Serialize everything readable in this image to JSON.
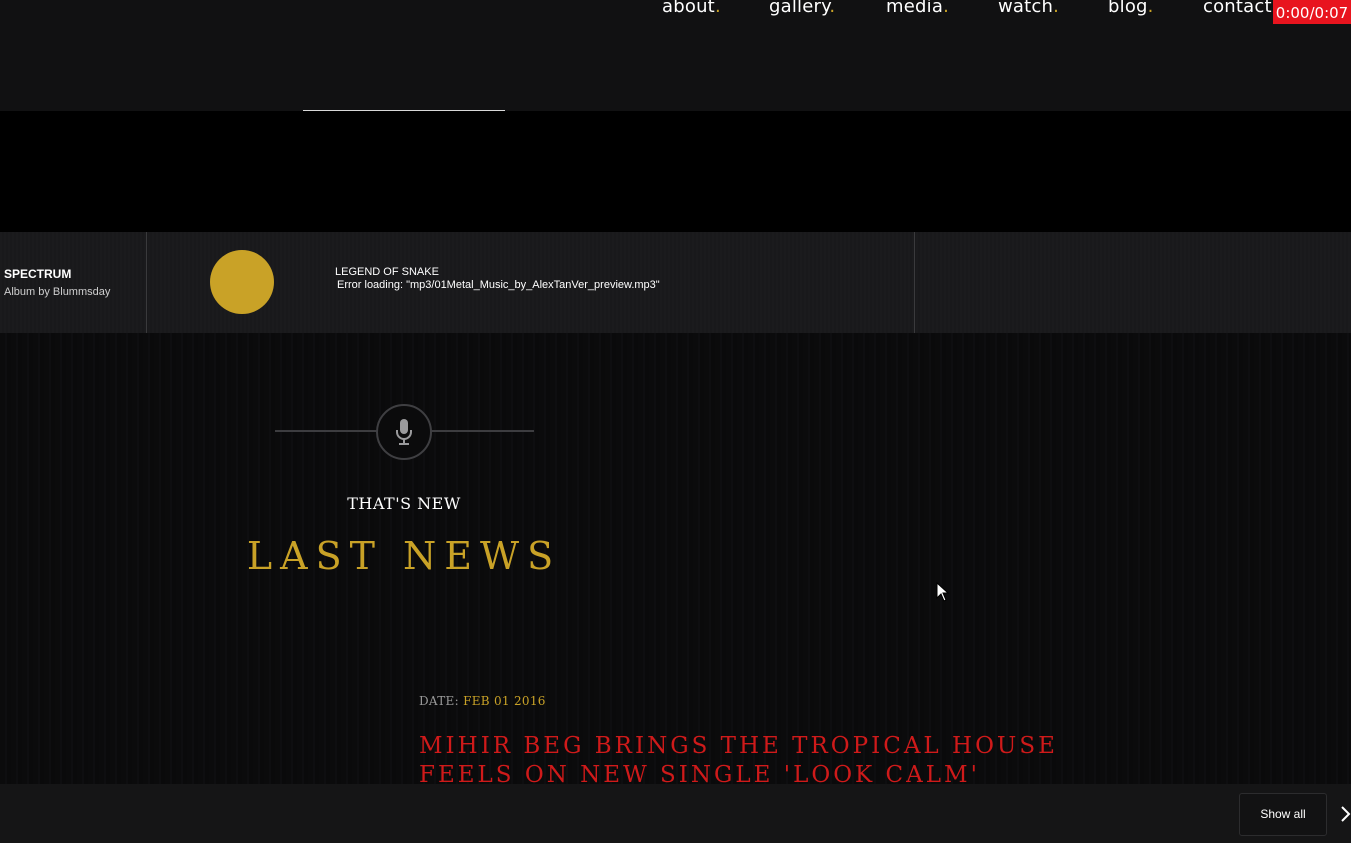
{
  "nav": {
    "items": [
      {
        "label": "about",
        "dot": "."
      },
      {
        "label": "gallery",
        "dot": "."
      },
      {
        "label": "media",
        "dot": "."
      },
      {
        "label": "watch",
        "dot": "."
      },
      {
        "label": "blog",
        "dot": "."
      },
      {
        "label": "contact",
        "dot": "."
      }
    ],
    "timer": "0:00/0:07"
  },
  "player": {
    "album_title": "SPECTRUM",
    "album_subtitle": "Album by Blummsday",
    "track_title": "LEGEND OF SNAKE",
    "error_text": "Error loading: \"mp3/01Metal_Music_by_AlexTanVer_preview.mp3\""
  },
  "section": {
    "icon": "microphone-icon",
    "subheading": "THAT'S NEW",
    "heading": "LAST NEWS"
  },
  "news": {
    "date_label": "DATE:",
    "date_value": "FEB 01 2016",
    "title": "MIHIR BEG BRINGS THE TROPICAL HOUSE FEELS ON NEW SINGLE 'LOOK CALM'"
  },
  "bottom_bar": {
    "show_all_label": "Show all",
    "next_icon": "chevron-right-icon"
  },
  "colors": {
    "accent_gold": "#c9a227",
    "news_red": "#cf1a1a",
    "timer_red": "#e8141e"
  }
}
